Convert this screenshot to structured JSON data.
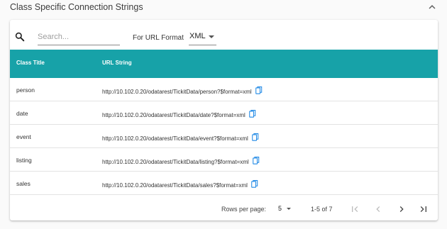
{
  "section": {
    "title": "Class Specific Connection Strings",
    "collapse_icon": "chevron-up-icon"
  },
  "toolbar": {
    "search_icon": "search-icon",
    "search_placeholder": "Search...",
    "search_value": "",
    "format_label": "For URL Format",
    "format_value": "XML"
  },
  "table": {
    "headers": [
      "Class Title",
      "URL String"
    ],
    "rows": [
      {
        "class_title": "person",
        "url": "http://10.102.0.20/odatarest/TickitData/person?$format=xml"
      },
      {
        "class_title": "date",
        "url": "http://10.102.0.20/odatarest/TickitData/date?$format=xml"
      },
      {
        "class_title": "event",
        "url": "http://10.102.0.20/odatarest/TickitData/event?$format=xml"
      },
      {
        "class_title": "listing",
        "url": "http://10.102.0.20/odatarest/TickitData/listing?$format=xml"
      },
      {
        "class_title": "sales",
        "url": "http://10.102.0.20/odatarest/TickitData/sales?$format=xml"
      }
    ],
    "copy_icon": "copy-icon",
    "header_color": "#17a2a8",
    "icon_color": "#1e88e5"
  },
  "pagination": {
    "rows_per_page_label": "Rows per page:",
    "rows_per_page_value": "5",
    "range_text": "1-5 of 7",
    "icons": [
      "first-page-icon",
      "previous-page-icon",
      "next-page-icon",
      "last-page-icon"
    ]
  }
}
